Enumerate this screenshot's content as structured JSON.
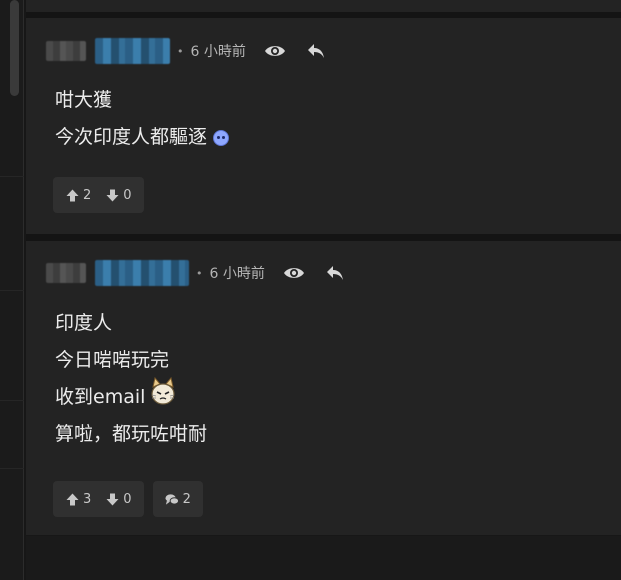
{
  "colors": {
    "background": "#171717",
    "card": "#232323",
    "button": "#303030",
    "text": "#ececec",
    "muted": "#b5b5b5",
    "username_blur": "#3b7eac"
  },
  "comments": [
    {
      "time": "6 小時前",
      "lines": [
        "咁大獲",
        "今次印度人都驅逐"
      ],
      "upvotes": "2",
      "downvotes": "0"
    },
    {
      "time": "6 小時前",
      "lines": [
        "印度人",
        "今日啱啱玩完",
        "收到email",
        "算啦，都玩咗咁耐"
      ],
      "upvotes": "3",
      "downvotes": "0",
      "replies": "2"
    }
  ],
  "icons": [
    "eye-icon",
    "reply-icon",
    "thumb-up-icon",
    "thumb-down-icon",
    "speech-bubble-icon",
    "sad-face-emoji",
    "cat-sticker"
  ]
}
